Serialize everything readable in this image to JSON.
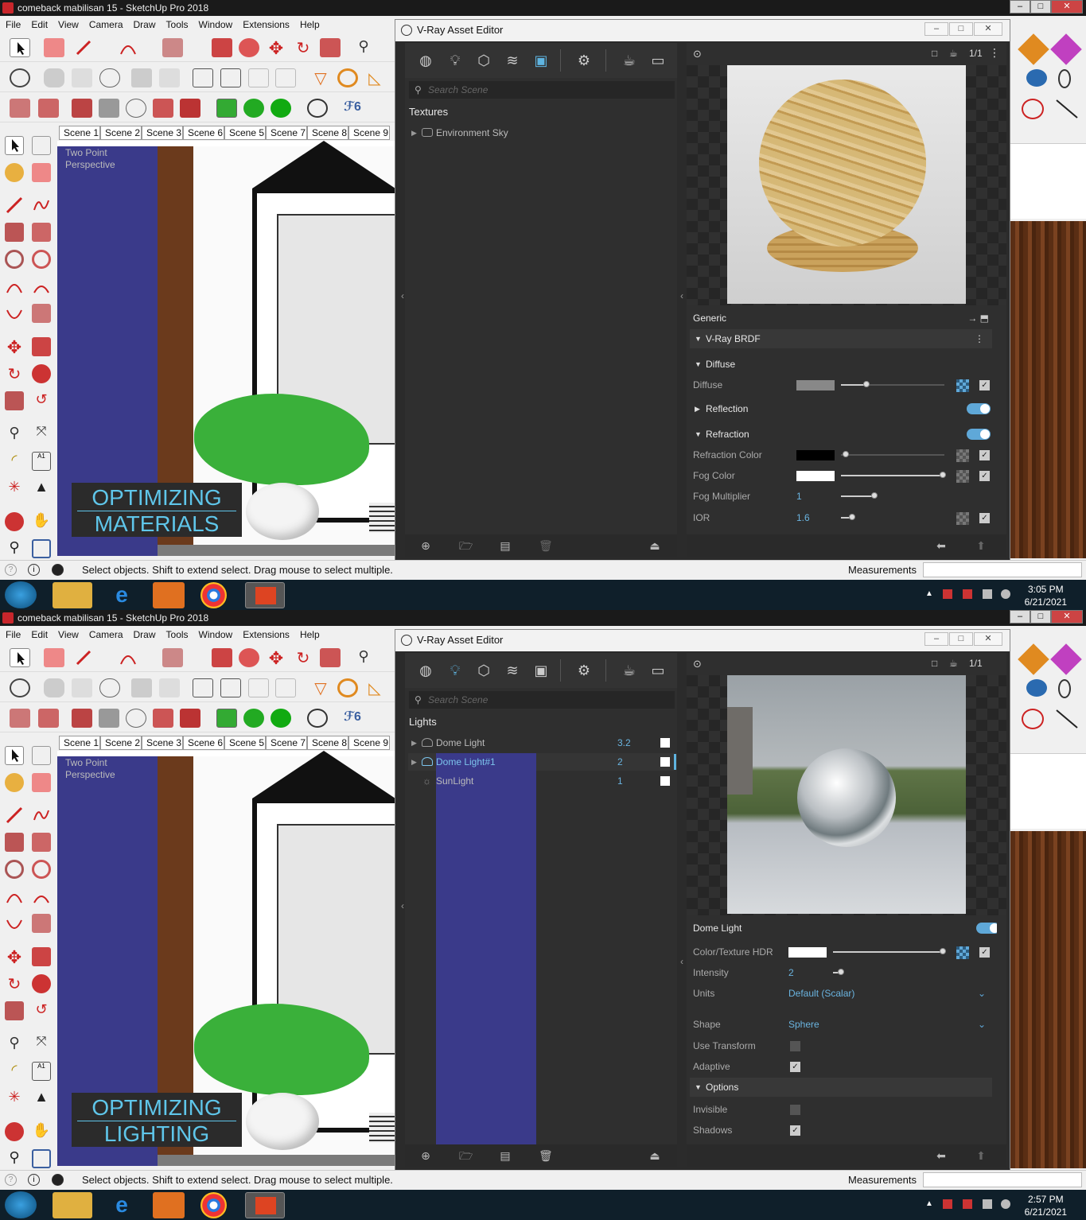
{
  "app": {
    "menus": [
      "File",
      "Edit",
      "View",
      "Camera",
      "Draw",
      "Tools",
      "Window",
      "Extensions",
      "Help"
    ],
    "scenes": [
      "Scene 1",
      "Scene 2",
      "Scene 3",
      "Scene 6",
      "Scene 5",
      "Scene 7",
      "Scene 8",
      "Scene 9"
    ],
    "viewport_label": "Two Point Perspective",
    "status_text": "Select objects. Shift to extend select. Drag mouse to select multiple.",
    "measurements_label": "Measurements",
    "vray_title": "V-Ray Asset Editor",
    "search_placeholder": "Search Scene"
  },
  "shot1": {
    "window_title": "comeback mabilisan 15 - SketchUp Pro 2018",
    "caption_line1": "OPTIMIZING",
    "caption_line2": "MATERIALS",
    "category": "Textures",
    "items": [
      {
        "name": "Environment Sky"
      }
    ],
    "props_header": "Generic",
    "brdf_label": "V-Ray BRDF",
    "diffuse_section": "Diffuse",
    "diffuse_label": "Diffuse",
    "reflection_section": "Reflection",
    "refraction_section": "Refraction",
    "refraction_color_label": "Refraction Color",
    "fog_color_label": "Fog Color",
    "fog_multiplier_label": "Fog Multiplier",
    "fog_multiplier_value": "1",
    "ior_label": "IOR",
    "ior_value": "1.6",
    "page_counter": "1/1",
    "clock_time": "3:05 PM",
    "clock_date": "6/21/2021"
  },
  "shot2": {
    "window_title": "comeback mabilisan 15 - SketchUp Pro 2018",
    "caption_line1": "OPTIMIZING",
    "caption_line2": "LIGHTING",
    "category": "Lights",
    "items": [
      {
        "name": "Dome Light",
        "value": "3.2"
      },
      {
        "name": "Dome Light#1",
        "value": "2"
      },
      {
        "name": "SunLight",
        "value": "1"
      }
    ],
    "props_header": "Dome Light",
    "color_label": "Color/Texture HDR",
    "intensity_label": "Intensity",
    "intensity_value": "2",
    "units_label": "Units",
    "units_value": "Default (Scalar)",
    "shape_label": "Shape",
    "shape_value": "Sphere",
    "use_transform_label": "Use Transform",
    "adaptive_label": "Adaptive",
    "options_section": "Options",
    "invisible_label": "Invisible",
    "shadows_label": "Shadows",
    "page_counter": "1/1",
    "clock_time": "2:57 PM",
    "clock_date": "6/21/2021"
  },
  "colors": {
    "accent": "#5fb4e0",
    "caption_text": "#5fc6ea",
    "toggle_on": "#5fa8d8"
  },
  "icons": [
    "select-icon",
    "eraser-icon",
    "pencil-icon",
    "arc-icon",
    "rectangle-icon",
    "push-pull-icon",
    "move-icon",
    "rotate-icon",
    "scale-icon",
    "tape-icon",
    "paint-bucket-icon",
    "orbit-icon",
    "pan-icon",
    "zoom-icon",
    "search-icon",
    "materials-icon",
    "lights-icon",
    "geometry-icon",
    "layers-icon",
    "render-elements-icon",
    "settings-icon",
    "interactive-render-icon",
    "frame-buffer-icon",
    "add-asset-icon",
    "open-folder-icon",
    "save-icon",
    "delete-icon",
    "purge-icon"
  ]
}
